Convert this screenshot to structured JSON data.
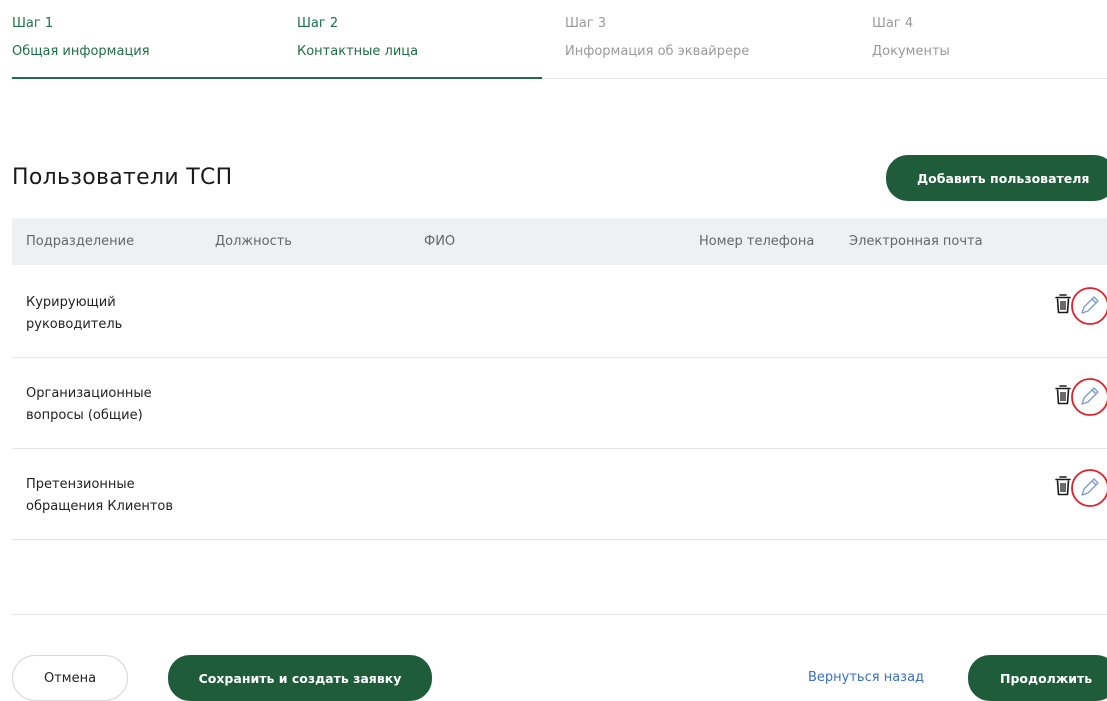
{
  "stepper": {
    "steps": [
      {
        "num": "Шаг 1",
        "name": "Общая информация"
      },
      {
        "num": "Шаг 2",
        "name": "Контактные лица"
      },
      {
        "num": "Шаг 3",
        "name": "Информация об эквайрере"
      },
      {
        "num": "Шаг 4",
        "name": "Документы"
      }
    ]
  },
  "section": {
    "title": "Пользователи ТСП",
    "add_button": "Добавить пользователя"
  },
  "table": {
    "columns": [
      "Подразделение",
      "Должность",
      "ФИО",
      "Номер телефона",
      "Электронная почта"
    ],
    "rows": [
      {
        "dept_line1": "Курирующий",
        "dept_line2": "руководитель"
      },
      {
        "dept_line1": "Организационные",
        "dept_line2": "вопросы (общие)"
      },
      {
        "dept_line1": "Претензионные",
        "dept_line2": "обращения Клиентов"
      }
    ]
  },
  "footer": {
    "cancel": "Отмена",
    "save": "Сохранить и создать заявку",
    "back": "Вернуться назад",
    "next": "Продолжить"
  },
  "colors": {
    "accent_green": "#1e5c3a",
    "step_active": "#1e6e47",
    "link_blue": "#3b6fc4",
    "highlight_red": "#e0202a"
  }
}
